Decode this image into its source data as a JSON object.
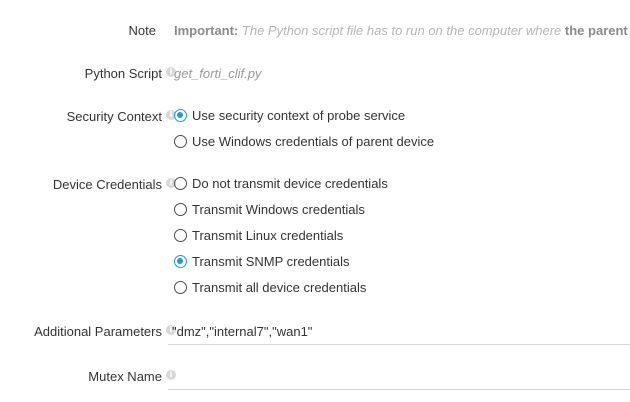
{
  "note": {
    "label": "Note",
    "important_prefix": "Important:",
    "text_before_bold": " The Python script file has to run on the computer where ",
    "bold_text": "the parent pro"
  },
  "python_script": {
    "label": "Python Script",
    "value": "get_forti_clif.py",
    "info_icon": "info-icon"
  },
  "security_context": {
    "label": "Security Context",
    "info_icon": "info-icon",
    "options": [
      {
        "label": "Use security context of probe service",
        "checked": true
      },
      {
        "label": "Use Windows credentials of parent device",
        "checked": false
      }
    ]
  },
  "device_credentials": {
    "label": "Device Credentials",
    "info_icon": "info-icon",
    "options": [
      {
        "label": "Do not transmit device credentials",
        "checked": false
      },
      {
        "label": "Transmit Windows credentials",
        "checked": false
      },
      {
        "label": "Transmit Linux credentials",
        "checked": false
      },
      {
        "label": "Transmit SNMP credentials",
        "checked": true
      },
      {
        "label": "Transmit all device credentials",
        "checked": false
      }
    ]
  },
  "additional_parameters": {
    "label": "Additional Parameters",
    "info_icon": "info-icon",
    "value": "\"dmz\",\"internal7\",\"wan1\""
  },
  "mutex_name": {
    "label": "Mutex Name",
    "info_icon": "info-icon",
    "value": ""
  },
  "colors": {
    "accent": "#1a9ad6",
    "text": "#333333",
    "muted": "#b5b5b5",
    "border": "#d6d6d6"
  }
}
